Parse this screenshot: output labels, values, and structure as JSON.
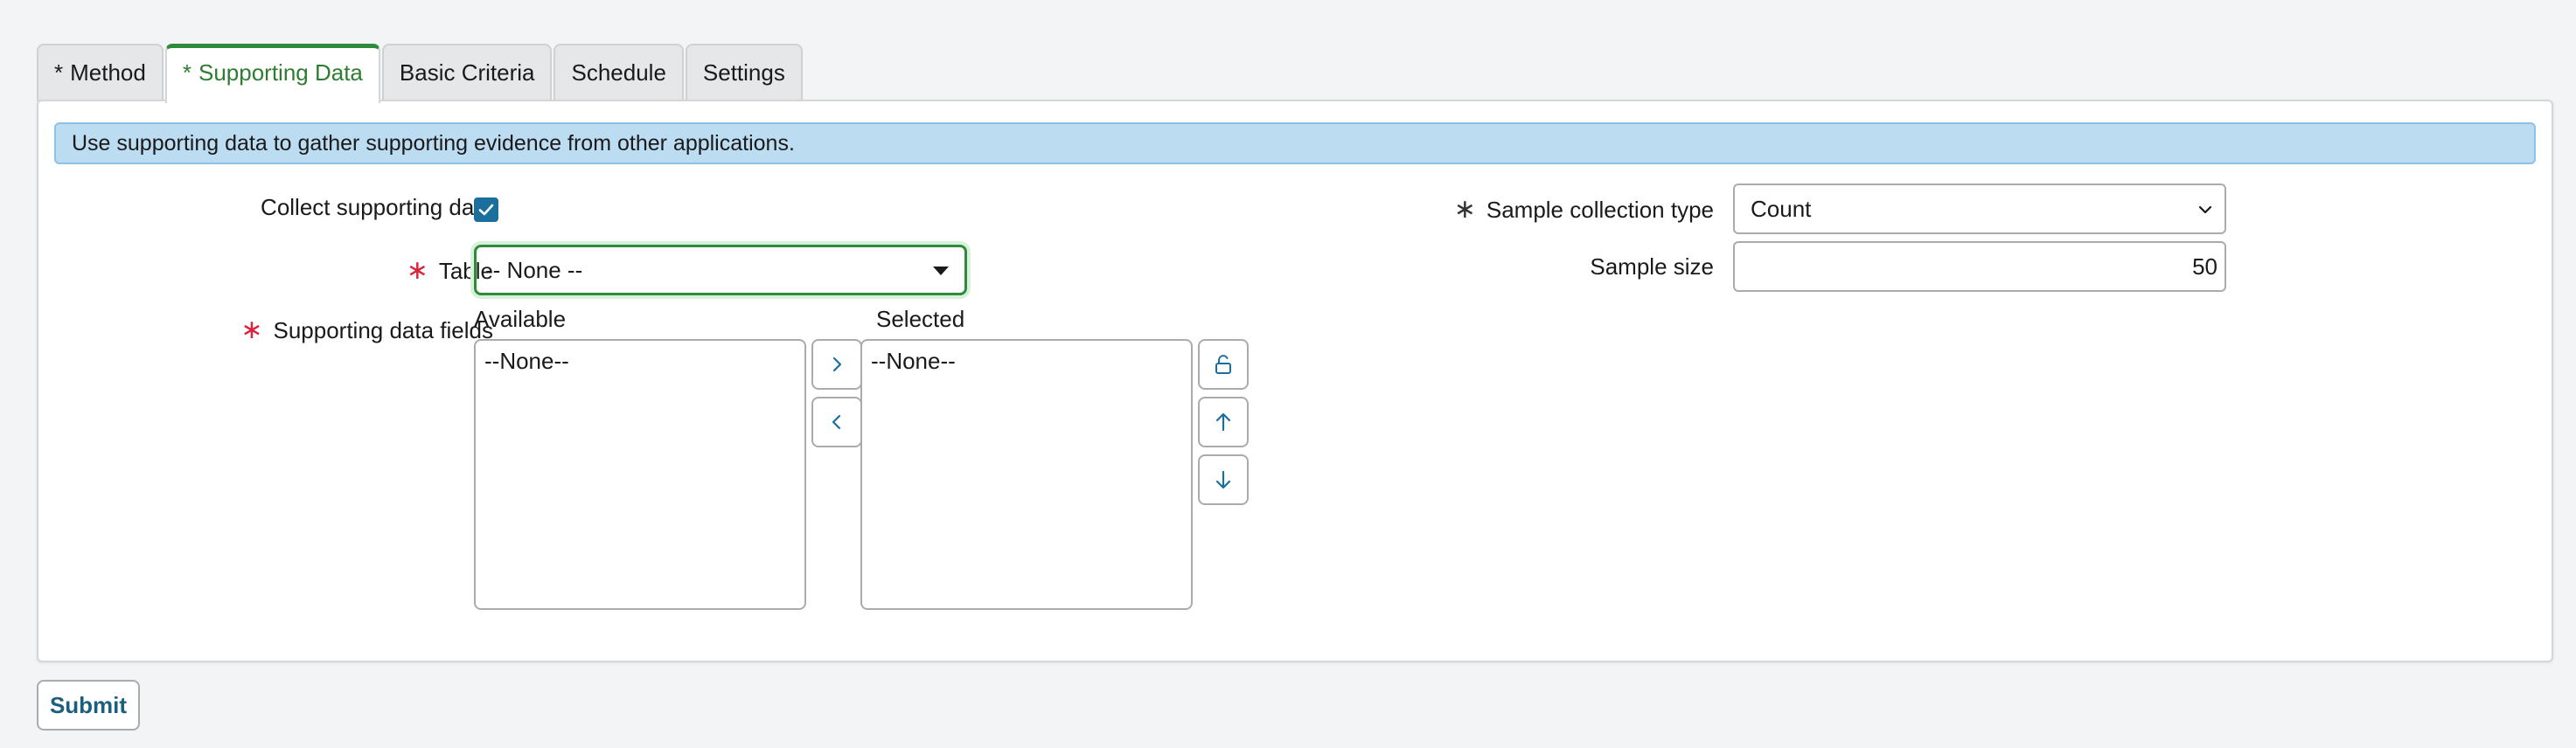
{
  "tabs": [
    {
      "star": "*",
      "label": "Method"
    },
    {
      "star": "*",
      "label": "Supporting Data"
    },
    {
      "label": "Basic Criteria"
    },
    {
      "label": "Schedule"
    },
    {
      "label": "Settings"
    }
  ],
  "active_tab": "Supporting Data",
  "info_message": "Use supporting data to gather supporting evidence from other applications.",
  "form": {
    "collect_label": "Collect supporting data",
    "collect_checked": true,
    "table_label": "Table",
    "table_value": "-- None --",
    "fields_label": "Supporting data fields",
    "available_label": "Available",
    "available_items": [
      "--None--"
    ],
    "selected_label": "Selected",
    "selected_items": [
      "--None--"
    ],
    "sample_type_label": "Sample collection type",
    "sample_type_value": "Count",
    "sample_size_label": "Sample size",
    "sample_size_value": "50"
  },
  "required_marker": "∗",
  "submit_label": "Submit",
  "colors": {
    "accent_green": "#2e8b3a",
    "info_bg": "#bcdcf2",
    "checkbox_blue": "#1b6f9c",
    "required_red": "#d9253c",
    "icon_teal": "#1b6f9c"
  }
}
